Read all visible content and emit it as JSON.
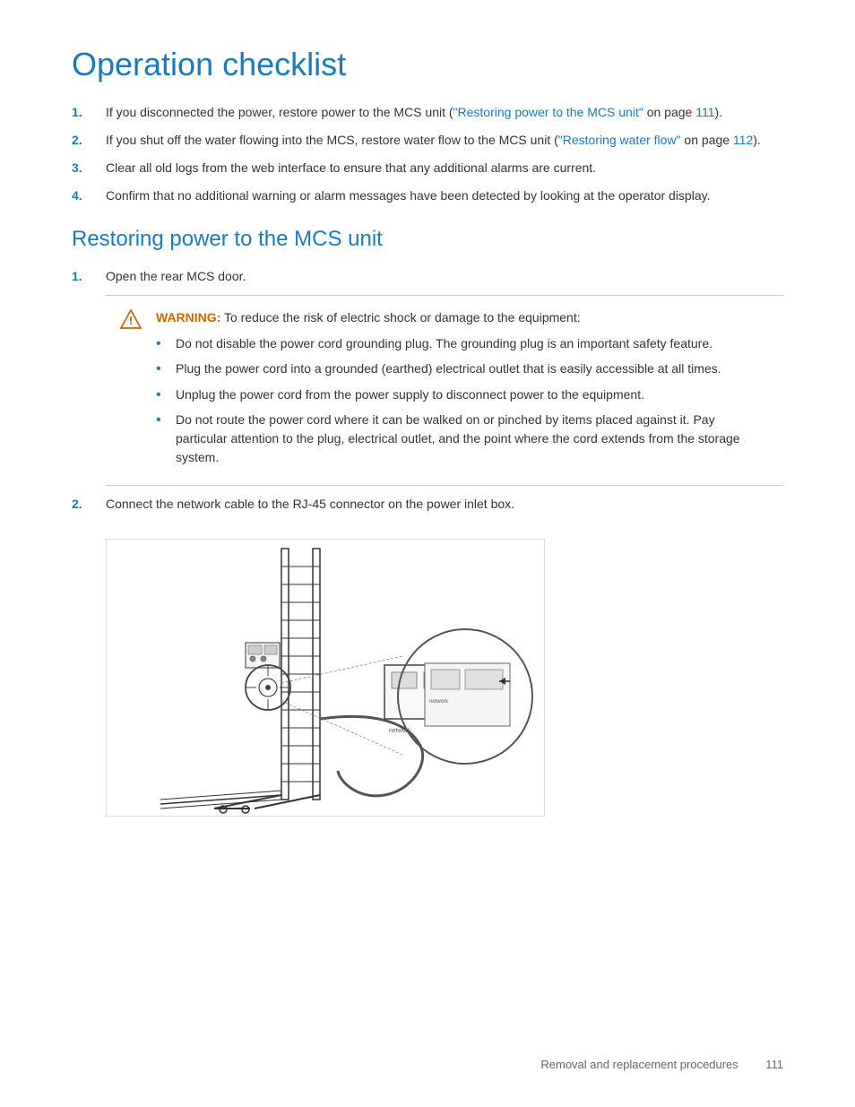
{
  "page": {
    "title": "Operation checklist",
    "section1": {
      "title": "Restoring power to the MCS unit",
      "items": [
        {
          "text_before_link": "If you disconnected the power, restore power to the MCS unit (",
          "link_text": "\"Restoring power to the MCS unit\"",
          "text_after_link": " on page ",
          "link_page": "111",
          "text_end": ")."
        },
        {
          "text_before_link": "If you shut off the water flowing into the MCS, restore water flow to the MCS unit (",
          "link_text": "\"Restoring water flow\"",
          "text_after_link": " on page ",
          "link_page": "112",
          "text_end": ")."
        },
        {
          "text": "Clear all old logs from the web interface to ensure that any additional alarms are current."
        },
        {
          "text": "Confirm that no additional warning or alarm messages have been detected by looking at the operator display."
        }
      ]
    },
    "section2": {
      "title": "Restoring power to the MCS unit",
      "step1": {
        "text": "Open the rear MCS door."
      },
      "warning": {
        "label": "WARNING:",
        "text": " To reduce the risk of electric shock or damage to the equipment:",
        "bullets": [
          "Do not disable the power cord grounding plug. The grounding plug is an important safety feature.",
          "Plug the power cord into a grounded (earthed) electrical outlet that is easily accessible at all times.",
          "Unplug the power cord from the power supply to disconnect power to the equipment.",
          "Do not route the power cord where it can be walked on or pinched by items placed against it. Pay particular attention to the plug, electrical outlet, and the point where the cord extends from the storage system."
        ]
      },
      "step2": {
        "text": "Connect the network cable to the RJ-45 connector on the power inlet box."
      }
    },
    "footer": {
      "text": "Removal and replacement procedures",
      "page_number": "111"
    }
  }
}
